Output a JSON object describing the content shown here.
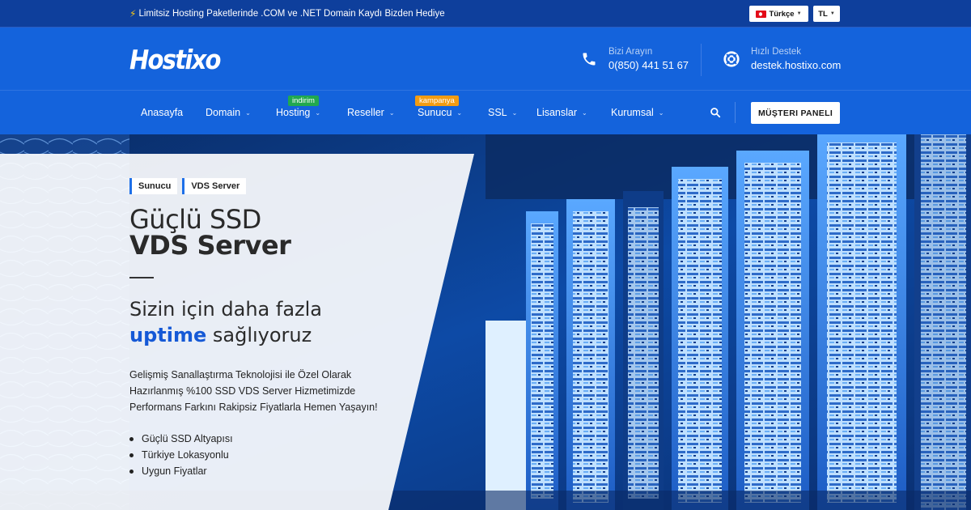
{
  "topbar": {
    "promo_text": "Limitsiz Hosting Paketlerinde .COM ve .NET Domain Kaydı Bizden Hediye",
    "language": "Türkçe",
    "currency": "TL"
  },
  "header": {
    "logo": "Hostixo",
    "phone": {
      "label": "Bizi Arayın",
      "value": "0(850) 441 51 67"
    },
    "support": {
      "label": "Hızlı Destek",
      "value": "destek.hostixo.com"
    }
  },
  "nav": {
    "items": [
      {
        "label": "Anasayfa"
      },
      {
        "label": "Domain"
      },
      {
        "label": "Hosting",
        "badge": "indirim"
      },
      {
        "label": "Reseller"
      },
      {
        "label": "Sunucu",
        "badge": "kampanya"
      },
      {
        "label": "SSL"
      },
      {
        "label": "Lisanslar"
      },
      {
        "label": "Kurumsal"
      }
    ],
    "panel_button": "MÜŞTERI PANELI"
  },
  "hero": {
    "breadcrumbs": [
      "Sunucu",
      "VDS Server"
    ],
    "title_light": "Güçlü SSD",
    "title_bold": "VDS Server",
    "subtitle_line1": "Sizin için daha fazla",
    "subtitle_highlight": "uptime",
    "subtitle_rest": " sağlıyoruz",
    "description_lines": [
      "Gelişmiş Sanallaştırma Teknolojisi ile Özel Olarak",
      "Hazırlanmış %100 SSD VDS Server Hizmetimizde",
      "Performans Farkını Rakipsiz Fiyatlarla Hemen Yaşayın!"
    ],
    "features": [
      "Güçlü SSD Altyapısı",
      "Türkiye Lokasyonlu",
      "Uygun Fiyatlar"
    ]
  },
  "colors": {
    "brand_blue": "#1463dc",
    "topbar_blue": "#0e3f9c",
    "badge_green": "#21a84f",
    "badge_orange": "#f39c12",
    "highlight_blue": "#1559d6"
  },
  "icons": {
    "promo": "bolt-icon",
    "phone": "phone-icon",
    "support": "lifebuoy-icon",
    "search": "search-icon",
    "language_flag": "turkey-flag-icon"
  }
}
